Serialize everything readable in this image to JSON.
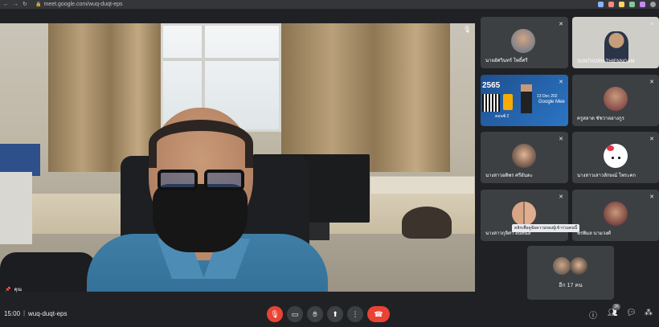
{
  "browser": {
    "url": "meet.google.com/wuq-duqt-eps",
    "nav": [
      "←",
      "→",
      "↻"
    ]
  },
  "main_video": {
    "label": "คุณ",
    "mic_icon": "mic-off-icon"
  },
  "tiles": [
    {
      "name": "นายอัศวินทร์ โพธิ์ศรี",
      "mic": "mic-off-icon"
    },
    {
      "name": "SUNTHORN THIENNGAM",
      "mic": "mic-off-icon"
    },
    {
      "name": "",
      "poster_lines": [
        "2565",
        "13 Dec 202",
        "Google Mee",
        "คอนซ์ 2"
      ],
      "mic": "mic-off-icon"
    },
    {
      "name": "ครูสลาด ชัชวาลอางกูร",
      "mic": "mic-off-icon"
    },
    {
      "name": "นางสาวอติพร ศรีอันตะ",
      "mic": "mic-off-icon"
    },
    {
      "name": "นางสาวเสาวลักษณ์ โพระคก",
      "mic": "mic-off-icon"
    },
    {
      "name": "นางสาวกุลิศา อินทนิล",
      "mic": "mic-off-icon"
    },
    {
      "name": "พรพิมล นามวงศ์",
      "mic": "mic-off-icon"
    }
  ],
  "tooltip": "คลิกเพื่อดูข้อความของผู้เข้าร่วมคนนี้",
  "more_participants": "อีก 17 คน",
  "bottom": {
    "time": "15:00",
    "separator": "|",
    "meeting_code": "wuq-duqt-eps",
    "participant_count": "26"
  },
  "colors": {
    "background": "#202124",
    "tile": "#3c4043",
    "danger": "#ea4335"
  }
}
